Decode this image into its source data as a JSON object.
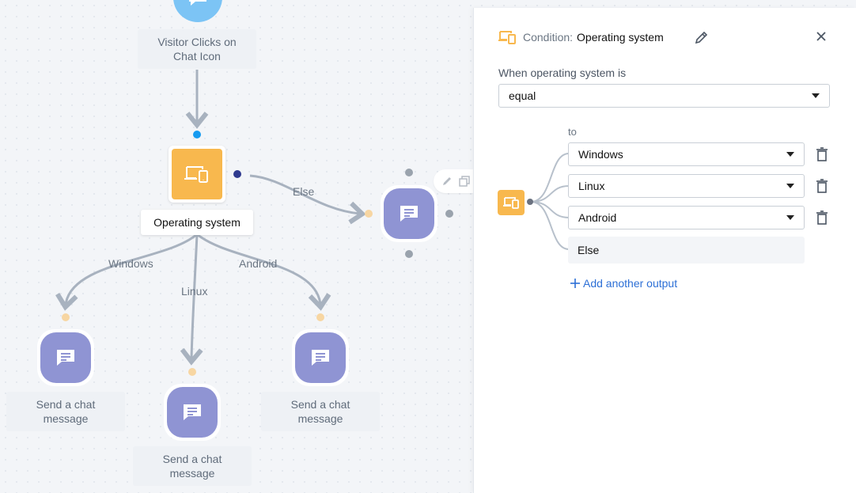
{
  "canvas": {
    "trigger": {
      "caption_line1": "Visitor Clicks on",
      "caption_line2": "Chat Icon",
      "icon": "chat-bubble-icon"
    },
    "condition_node": {
      "caption": "Operating system",
      "icon": "devices-icon"
    },
    "edges": {
      "else": "Else",
      "windows": "Windows",
      "linux": "Linux",
      "android": "Android"
    },
    "messages": [
      {
        "line1": "Send a chat",
        "line2": "message"
      },
      {
        "line1": "Send a chat",
        "line2": "message"
      },
      {
        "line1": "Send a chat",
        "line2": "message"
      }
    ]
  },
  "panel": {
    "header": {
      "label": "Condition:",
      "value": "Operating system"
    },
    "field_label": "When operating system is",
    "operator": "equal",
    "to_label": "to",
    "outputs": [
      "Windows",
      "Linux",
      "Android"
    ],
    "else_label": "Else",
    "add_output": "Add another output"
  },
  "colors": {
    "condition": "#f8b84e",
    "message": "#8f94d3",
    "trigger": "#7cc4f5",
    "link": "#2c6fd6"
  }
}
